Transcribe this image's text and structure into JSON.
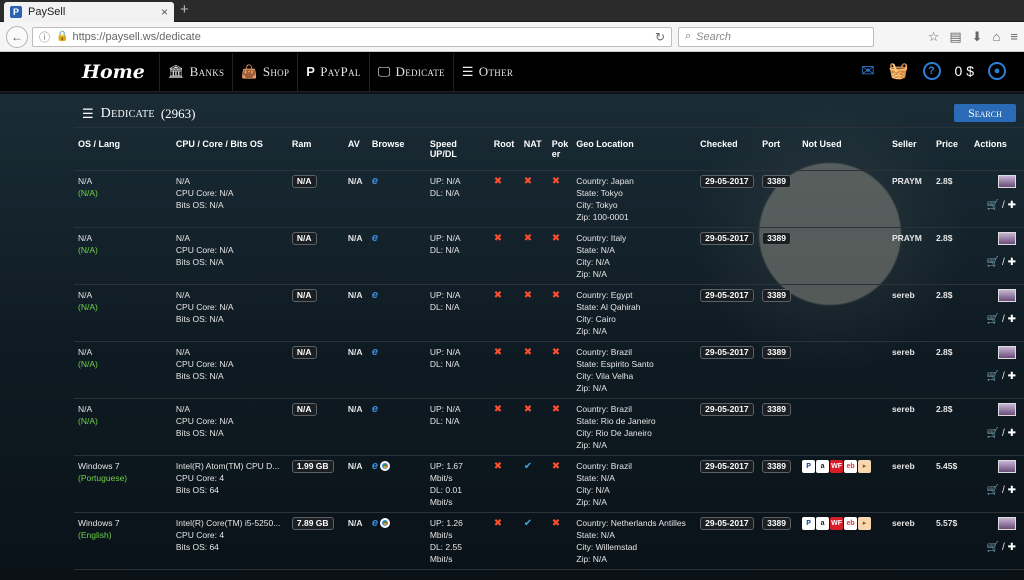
{
  "browser": {
    "tab_title": "PaySell",
    "tab_favicon": "P",
    "url": "https://paysell.ws/dedicate",
    "search_placeholder": "Search"
  },
  "site": {
    "logo": "Home",
    "menu": [
      {
        "label": "Banks",
        "icon": "bank-icon"
      },
      {
        "label": "Shop",
        "icon": "shopping-bag-icon"
      },
      {
        "label": "PayPal",
        "icon": "paypal-icon"
      },
      {
        "label": "Dedicate",
        "icon": "monitor-icon"
      },
      {
        "label": "Other",
        "icon": "server-icon"
      }
    ],
    "balance": "0 $"
  },
  "panel": {
    "title": "Dedicate",
    "count": "(2963)",
    "search_label": "Search"
  },
  "table": {
    "headers": {
      "os": "OS / Lang",
      "cpu": "CPU / Core / Bits OS",
      "ram": "Ram",
      "av": "AV",
      "browse": "Browse",
      "speed": "Speed UP/DL",
      "root": "Root",
      "nat": "NAT",
      "poker": "Pok er",
      "geo": "Geo Location",
      "checked": "Checked",
      "port": "Port",
      "notused": "Not Used",
      "seller": "Seller",
      "price": "Price",
      "actions": "Actions"
    },
    "rows": [
      {
        "os": "N/A",
        "lang": "(N/A)",
        "cpu": "N/A",
        "core": "CPU Core: N/A",
        "bits": "Bits OS: N/A",
        "ram": "N/A",
        "av": "N/A",
        "up": "UP: N/A",
        "dl": "DL: N/A",
        "nat": "no",
        "country": "Country: Japan",
        "state": "State: Tokyo",
        "city": "City: Tokyo",
        "zip": "Zip: 100-0001",
        "checked": "29-05-2017",
        "port": "3389",
        "seller": "PRAYM",
        "price": "2.8$"
      },
      {
        "os": "N/A",
        "lang": "(N/A)",
        "cpu": "N/A",
        "core": "CPU Core: N/A",
        "bits": "Bits OS: N/A",
        "ram": "N/A",
        "av": "N/A",
        "up": "UP: N/A",
        "dl": "DL: N/A",
        "nat": "no",
        "country": "Country: Italy",
        "state": "State: N/A",
        "city": "City: N/A",
        "zip": "Zip: N/A",
        "checked": "29-05-2017",
        "port": "3389",
        "seller": "PRAYM",
        "price": "2.8$"
      },
      {
        "os": "N/A",
        "lang": "(N/A)",
        "cpu": "N/A",
        "core": "CPU Core: N/A",
        "bits": "Bits OS: N/A",
        "ram": "N/A",
        "av": "N/A",
        "up": "UP: N/A",
        "dl": "DL: N/A",
        "nat": "no",
        "country": "Country: Egypt",
        "state": "State: Al Qahirah",
        "city": "City: Cairo",
        "zip": "Zip: N/A",
        "checked": "29-05-2017",
        "port": "3389",
        "seller": "sereb",
        "price": "2.8$"
      },
      {
        "os": "N/A",
        "lang": "(N/A)",
        "cpu": "N/A",
        "core": "CPU Core: N/A",
        "bits": "Bits OS: N/A",
        "ram": "N/A",
        "av": "N/A",
        "up": "UP: N/A",
        "dl": "DL: N/A",
        "nat": "no",
        "country": "Country: Brazil",
        "state": "State: Espirito Santo",
        "city": "City: Vila Velha",
        "zip": "Zip: N/A",
        "checked": "29-05-2017",
        "port": "3389",
        "seller": "sereb",
        "price": "2.8$"
      },
      {
        "os": "N/A",
        "lang": "(N/A)",
        "cpu": "N/A",
        "core": "CPU Core: N/A",
        "bits": "Bits OS: N/A",
        "ram": "N/A",
        "av": "N/A",
        "up": "UP: N/A",
        "dl": "DL: N/A",
        "nat": "no",
        "country": "Country: Brazil",
        "state": "State: Rio de Janeiro",
        "city": "City: Rio De Janeiro",
        "zip": "Zip: N/A",
        "checked": "29-05-2017",
        "port": "3389",
        "seller": "sereb",
        "price": "2.8$"
      },
      {
        "os": "Windows 7",
        "lang": "(Portuguese)",
        "cpu": "Intel(R) Atom(TM) CPU D...",
        "core": "CPU Core: 4",
        "bits": "Bits OS: 64",
        "ram": "1.99 GB",
        "av": "N/A",
        "up": "UP: 1.67 Mbit/s",
        "dl": "DL: 0.01 Mbit/s",
        "nat": "yes",
        "country": "Country: Brazil",
        "state": "State: N/A",
        "city": "City: N/A",
        "zip": "Zip: N/A",
        "checked": "29-05-2017",
        "port": "3389",
        "seller": "sereb",
        "price": "5.45$"
      },
      {
        "os": "Windows 7",
        "lang": "(English)",
        "cpu": "Intel(R) Core(TM) i5-5250...",
        "core": "CPU Core: 4",
        "bits": "Bits OS: 64",
        "ram": "7.89 GB",
        "av": "N/A",
        "up": "UP: 1.26 Mbit/s",
        "dl": "DL: 2.55 Mbit/s",
        "nat": "yes",
        "country": "Country: Netherlands Antilles",
        "state": "State: N/A",
        "city": "City: Willemstad",
        "zip": "Zip: N/A",
        "checked": "29-05-2017",
        "port": "3389",
        "seller": "sereb",
        "price": "5.57$"
      }
    ]
  }
}
